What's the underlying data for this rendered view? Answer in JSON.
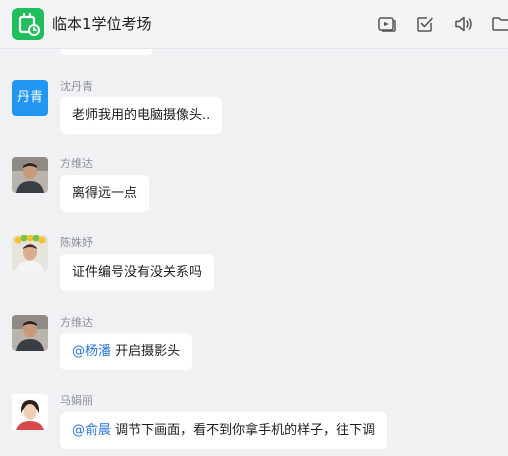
{
  "header": {
    "title": "临本1学位考场",
    "icons": [
      "app-logo-icon",
      "video-screen-icon",
      "task-check-icon",
      "speaker-icon",
      "folder-icon"
    ],
    "brand_color": "#1fbe5a"
  },
  "messages": [
    {
      "sender": "沈丹青",
      "avatar_text": "丹青",
      "text": "老师我用的电脑摄像头.."
    },
    {
      "sender": "方维达",
      "text": "离得远一点"
    },
    {
      "sender": "陈姝妤",
      "text": "证件编号没有没关系吗"
    },
    {
      "sender": "方维达",
      "mention": "@杨潘",
      "text": "开启摄影头"
    },
    {
      "sender": "马娟丽",
      "mention": "@俞晨",
      "text": "调节下画面，看不到你拿手机的样子，往下调"
    }
  ],
  "colors": {
    "mention": "#2a74d8",
    "avatar_text_bg": "#2196f3"
  }
}
